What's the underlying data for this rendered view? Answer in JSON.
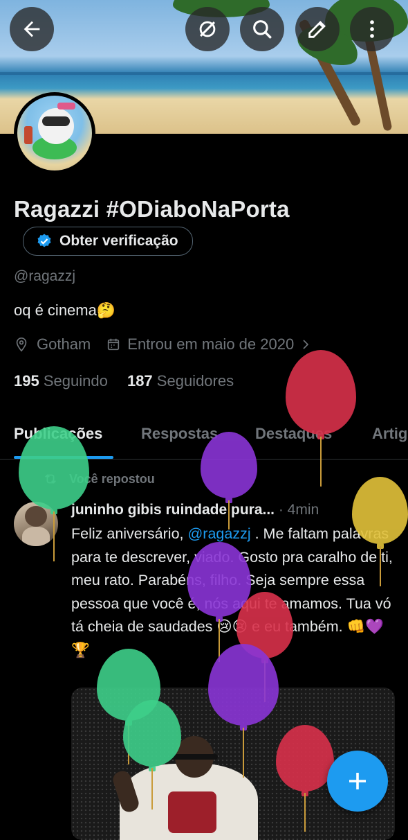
{
  "profile": {
    "name": "Ragazzi #ODiaboNaPorta",
    "verify_label": "Obter verificação",
    "handle": "@ragazzj",
    "bio": "oq é cinema🤔",
    "location": "Gotham",
    "joined": "Entrou em maio de 2020",
    "following_count": "195",
    "following_label": "Seguindo",
    "followers_count": "187",
    "followers_label": "Seguidores"
  },
  "tabs": [
    "Publicações",
    "Respostas",
    "Destaques",
    "Artig"
  ],
  "post": {
    "repost_label": "Você repostou",
    "author": "juninho gibis ruindade pura...",
    "time": "· 4min",
    "text_before": "Feliz aniversário, ",
    "mention": "@ragazzj",
    "text_after": " . Me faltam palavras para te descrever, viado. Gosto pra caralho de ti, meu rato. Parabéns, filho. Seja sempre essa pessoa que você é, nós aqui te amamos. Tua vó tá cheia de saudades 😢😢 e eu também. 👊💜🏆"
  },
  "colors": {
    "accent": "#1d9bf0",
    "muted": "#71767b",
    "text": "#e7e9ea"
  },
  "icons": [
    "back-arrow-icon",
    "no-wifi-icon",
    "search-icon",
    "edit-icon",
    "more-vertical-icon",
    "verified-badge-icon",
    "location-pin-icon",
    "calendar-icon",
    "chevron-right-icon",
    "repost-icon",
    "plus-icon"
  ]
}
